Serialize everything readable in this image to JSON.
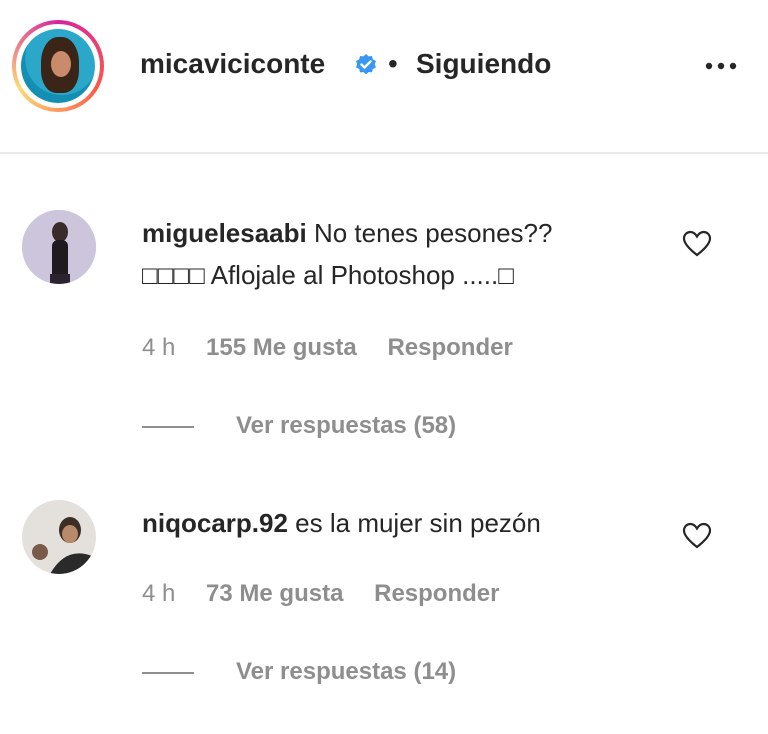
{
  "header": {
    "username": "micaviciconte",
    "separator": "•",
    "follow_status": "Siguiendo",
    "more_label": "..."
  },
  "comments": [
    {
      "user": "miguelesaabi",
      "text_line1": "No tenes pesones??",
      "text_line2": "□□□□ Aflojale al Photoshop .....□",
      "time": "4 h",
      "likes": "155 Me gusta",
      "reply": "Responder",
      "view_replies": "Ver respuestas (58)"
    },
    {
      "user": "niqocarp.92",
      "text_line1": "es la mujer sin pezón",
      "time": "4 h",
      "likes": "73 Me gusta",
      "reply": "Responder",
      "view_replies": "Ver respuestas (14)"
    }
  ],
  "colors": {
    "text": "#262626",
    "secondary": "#8e8e8e",
    "verified": "#3897f0",
    "divider": "#ebebeb"
  }
}
